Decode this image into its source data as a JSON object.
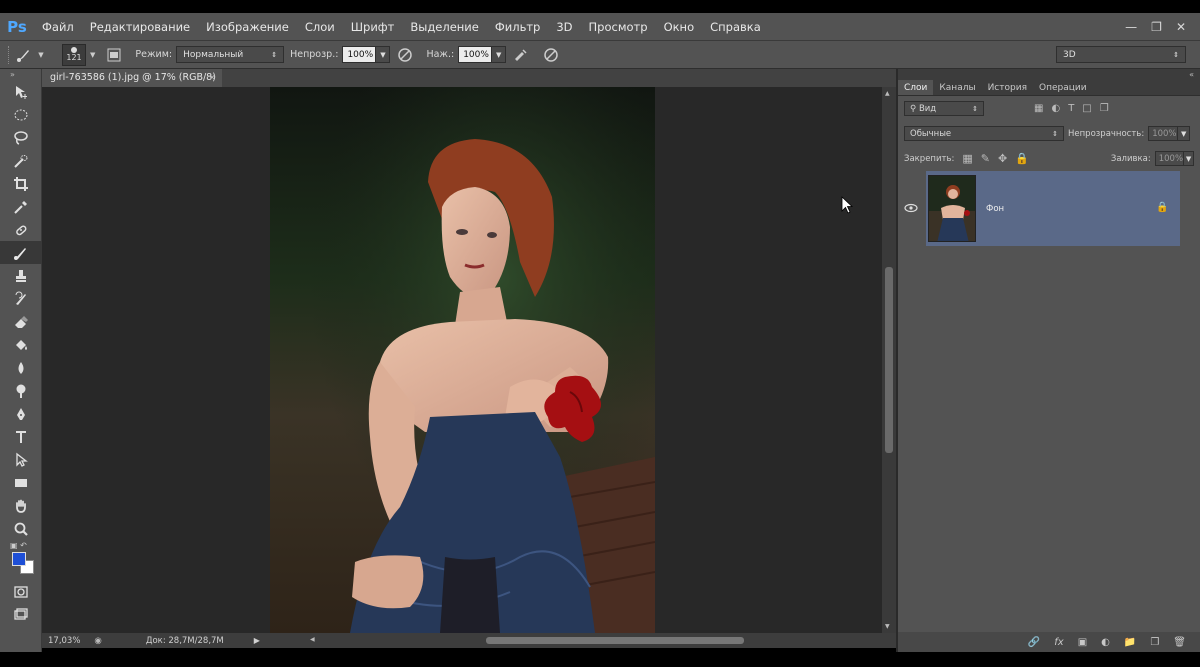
{
  "app": {
    "logo": "Ps",
    "menu": [
      "Файл",
      "Редактирование",
      "Изображение",
      "Слои",
      "Шрифт",
      "Выделение",
      "Фильтр",
      "3D",
      "Просмотр",
      "Окно",
      "Справка"
    ]
  },
  "options": {
    "brush_size": "121",
    "mode_label": "Режим:",
    "mode_value": "Нормальный",
    "opacity_label": "Непрозр.:",
    "opacity_value": "100%",
    "flow_label": "Наж.:",
    "flow_value": "100%",
    "workspace": "3D"
  },
  "document": {
    "tab_title": "girl-763586 (1).jpg @ 17% (RGB/8)",
    "tab_close": "×",
    "zoom": "17,03%",
    "doc_info": "Док: 28,7M/28,7M"
  },
  "tools": [
    "move",
    "marquee",
    "lasso",
    "quick-select",
    "crop",
    "eyedropper",
    "healing",
    "brush",
    "stamp",
    "history-brush",
    "eraser",
    "paint-bucket",
    "blur",
    "dodge",
    "pen",
    "type",
    "path-select",
    "rectangle",
    "hand",
    "zoom"
  ],
  "colors": {
    "foreground": "#1e4fd6",
    "background": "#ffffff"
  },
  "layers_panel": {
    "tabs": [
      "Слои",
      "Каналы",
      "История",
      "Операции"
    ],
    "active_tab": "Слои",
    "filter_label": "Вид",
    "blend_mode": "Обычные",
    "opacity_label": "Непрозрачность:",
    "opacity_value": "100%",
    "lock_label": "Закрепить:",
    "fill_label": "Заливка:",
    "fill_value": "100%",
    "layers": [
      {
        "name": "Фон",
        "visible": true,
        "locked": true
      }
    ]
  }
}
